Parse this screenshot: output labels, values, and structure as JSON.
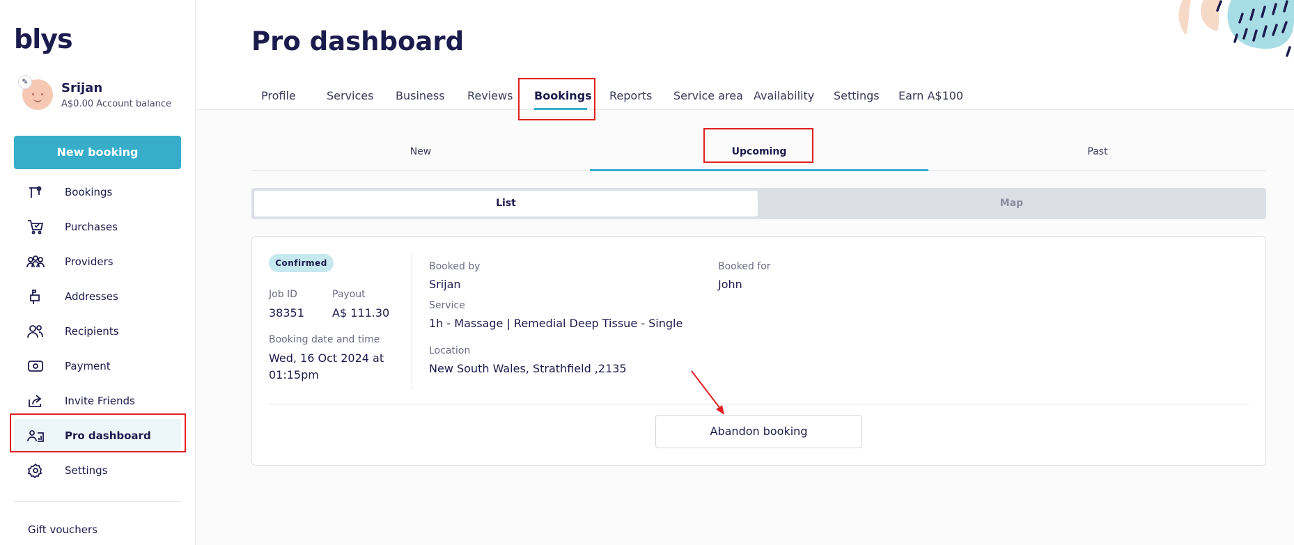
{
  "brand": {
    "logo": "blys"
  },
  "user": {
    "name": "Srijan",
    "balance": "A$0.00 Account balance"
  },
  "sidebar": {
    "new_booking": "New booking",
    "items": [
      {
        "label": "Bookings",
        "icon": "booking-icon"
      },
      {
        "label": "Purchases",
        "icon": "cart-icon"
      },
      {
        "label": "Providers",
        "icon": "providers-icon"
      },
      {
        "label": "Addresses",
        "icon": "mailbox-icon"
      },
      {
        "label": "Recipients",
        "icon": "people-icon"
      },
      {
        "label": "Payment",
        "icon": "payment-icon"
      },
      {
        "label": "Invite Friends",
        "icon": "share-icon"
      },
      {
        "label": "Pro dashboard",
        "icon": "pro-dashboard-icon",
        "active": true
      },
      {
        "label": "Settings",
        "icon": "gear-icon"
      }
    ],
    "gift_vouchers": "Gift vouchers"
  },
  "header": {
    "title": "Pro dashboard",
    "tabs": [
      "Profile",
      "Services",
      "Business",
      "Reviews",
      "Bookings",
      "Reports",
      "Service area",
      "Availability",
      "Settings",
      "Earn A$100"
    ],
    "active_tab": "Bookings"
  },
  "subtabs": {
    "items": [
      "New",
      "Upcoming",
      "Past"
    ],
    "active": "Upcoming"
  },
  "view_toggle": {
    "options": [
      "List",
      "Map"
    ],
    "active": "List"
  },
  "booking": {
    "status": "Confirmed",
    "job_id_label": "Job ID",
    "job_id": "38351",
    "payout_label": "Payout",
    "payout": "A$ 111.30",
    "date_label": "Booking date and time",
    "date_line1": "Wed, 16 Oct 2024 at",
    "date_line2": "01:15pm",
    "booked_by_label": "Booked by",
    "booked_by": "Srijan",
    "booked_for_label": "Booked for",
    "booked_for": "John",
    "service_label": "Service",
    "service": "1h - Massage | Remedial Deep Tissue - Single",
    "location_label": "Location",
    "location": "New South Wales, Strathfield ,2135",
    "abandon_label": "Abandon booking"
  },
  "colors": {
    "accent": "#38adca",
    "navy": "#1c1b4d",
    "annotation": "#e02020"
  }
}
